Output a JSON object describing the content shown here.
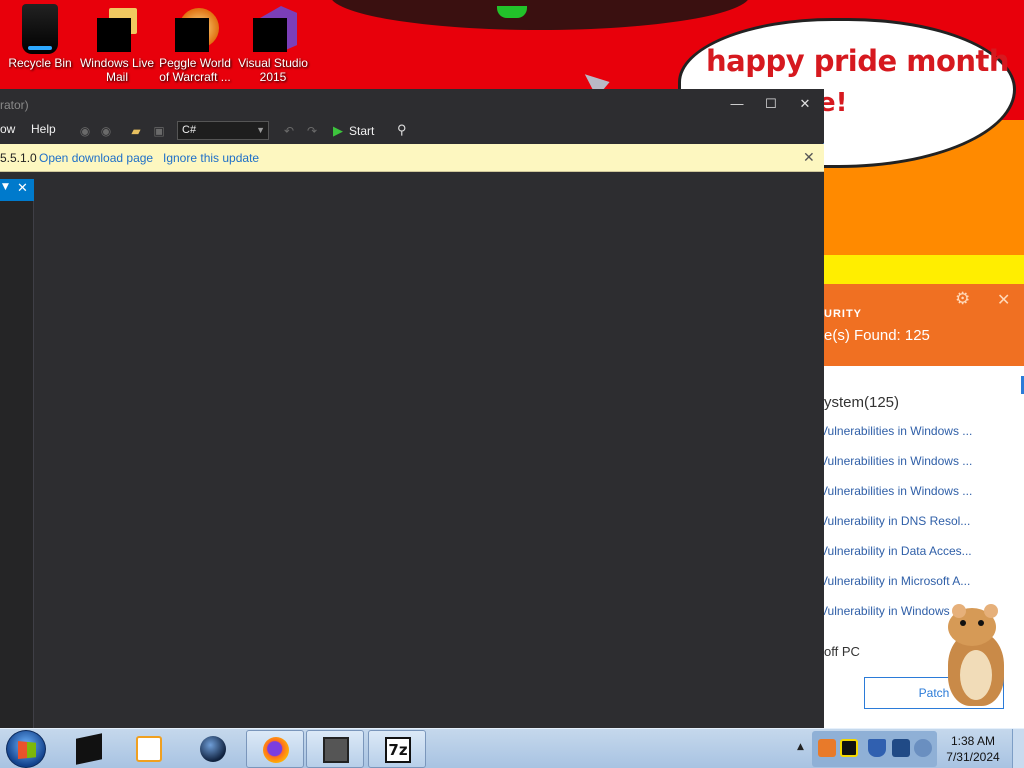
{
  "wallpaper": {
    "speech_text": "happy pride month",
    "speech_text_2": "e!"
  },
  "desktop_icons": [
    {
      "label": "Recycle Bin",
      "icon": "recycle-bin-icon"
    },
    {
      "label": "Windows Live Mail",
      "icon": "windows-live-mail-icon"
    },
    {
      "label": "Peggle World of Warcraft ...",
      "icon": "peggle-icon"
    },
    {
      "label": "Visual Studio 2015",
      "icon": "visual-studio-icon"
    }
  ],
  "ide": {
    "title_fragment": "rator)",
    "window_controls": {
      "minimize": "—",
      "maximize": "☐",
      "close": "✕"
    },
    "menu": {
      "fragment": "ow",
      "help": "Help"
    },
    "language": "C#",
    "start_label": "Start",
    "update_bar": {
      "version": "5.5.1.0",
      "open_link": "Open download page",
      "ignore_link": "Ignore this update",
      "close": "✕"
    },
    "side_tab": {
      "dropdown": "▼",
      "close": "✕"
    }
  },
  "security_popup": {
    "title": "URITY",
    "found": "e(s) Found: 125",
    "system": "ystem(125)",
    "vulnerabilities": [
      "Vulnerabilities in Windows ...",
      "Vulnerabilities in Windows ...",
      "Vulnerabilities in Windows ...",
      "Vulnerability in DNS Resol...",
      "Vulnerability in Data Acces...",
      "Vulnerability in Microsoft A...",
      "Vulnerability in Windows ..."
    ],
    "off_pc": "off PC",
    "patch_button": "Patch"
  },
  "taskbar": {
    "apps": [
      {
        "name": "black-box-app-icon",
        "active": false
      },
      {
        "name": "media-player-icon",
        "active": false
      },
      {
        "name": "globe-app-icon",
        "active": false
      },
      {
        "name": "firefox-icon",
        "active": true
      },
      {
        "name": "task-view-icon",
        "active": true
      },
      {
        "name": "7zip-icon",
        "active": true,
        "label": "7z"
      }
    ],
    "clock": {
      "time": "1:38 AM",
      "date": "7/31/2024"
    }
  },
  "colors": {
    "wallpaper_red": "#e8000b",
    "ide_background": "#2d2d30",
    "accent_blue": "#007acc",
    "update_bar": "#fdf7c0",
    "security_orange": "#f07022"
  }
}
